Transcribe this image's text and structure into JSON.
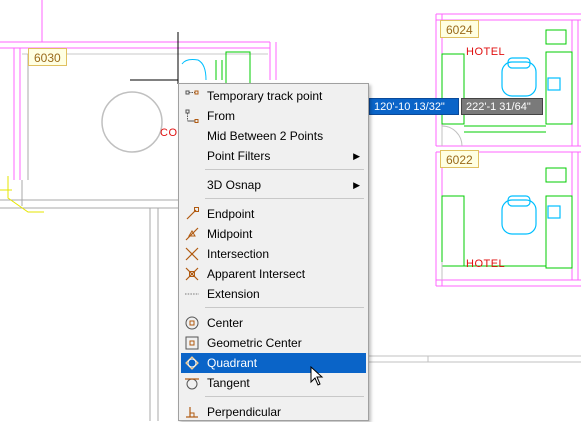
{
  "canvas": {
    "rooms": [
      {
        "number": "6030"
      },
      {
        "number": "6024"
      },
      {
        "number": "6022"
      }
    ],
    "labels": {
      "hotel_top": "HOTEL",
      "hotel_bottom": "HOTEL",
      "clipped_left": "CO"
    },
    "coordinates": {
      "x_value": "120'-10 13/32\"",
      "y_value": "222'-1 31/64\""
    }
  },
  "osnap_menu": {
    "selected_item": "Quadrant",
    "items": [
      {
        "label": "Temporary track point",
        "icon": "temporary-track-icon"
      },
      {
        "label": "From",
        "icon": "from-icon"
      },
      {
        "label": "Mid Between 2 Points",
        "icon": ""
      },
      {
        "label": "Point Filters",
        "icon": "",
        "submenu": true
      },
      {
        "label": "3D Osnap",
        "icon": "",
        "submenu": true
      },
      {
        "label": "Endpoint",
        "icon": "endpoint-icon"
      },
      {
        "label": "Midpoint",
        "icon": "midpoint-icon"
      },
      {
        "label": "Intersection",
        "icon": "intersection-icon"
      },
      {
        "label": "Apparent Intersect",
        "icon": "apparent-intersect-icon"
      },
      {
        "label": "Extension",
        "icon": "extension-icon"
      },
      {
        "label": "Center",
        "icon": "center-icon"
      },
      {
        "label": "Geometric Center",
        "icon": "geometric-center-icon"
      },
      {
        "label": "Quadrant",
        "icon": "quadrant-icon"
      },
      {
        "label": "Tangent",
        "icon": "tangent-icon"
      },
      {
        "label": "Perpendicular",
        "icon": "perpendicular-icon"
      }
    ]
  },
  "colors": {
    "wall": "#ff66ff",
    "furniture": "#00cc00",
    "chair": "#00bfff",
    "room_tag_text": "#9a6a1a",
    "label_red": "#e01010",
    "menu_highlight": "#0a64c8",
    "icon_orange": "#b05a10"
  }
}
